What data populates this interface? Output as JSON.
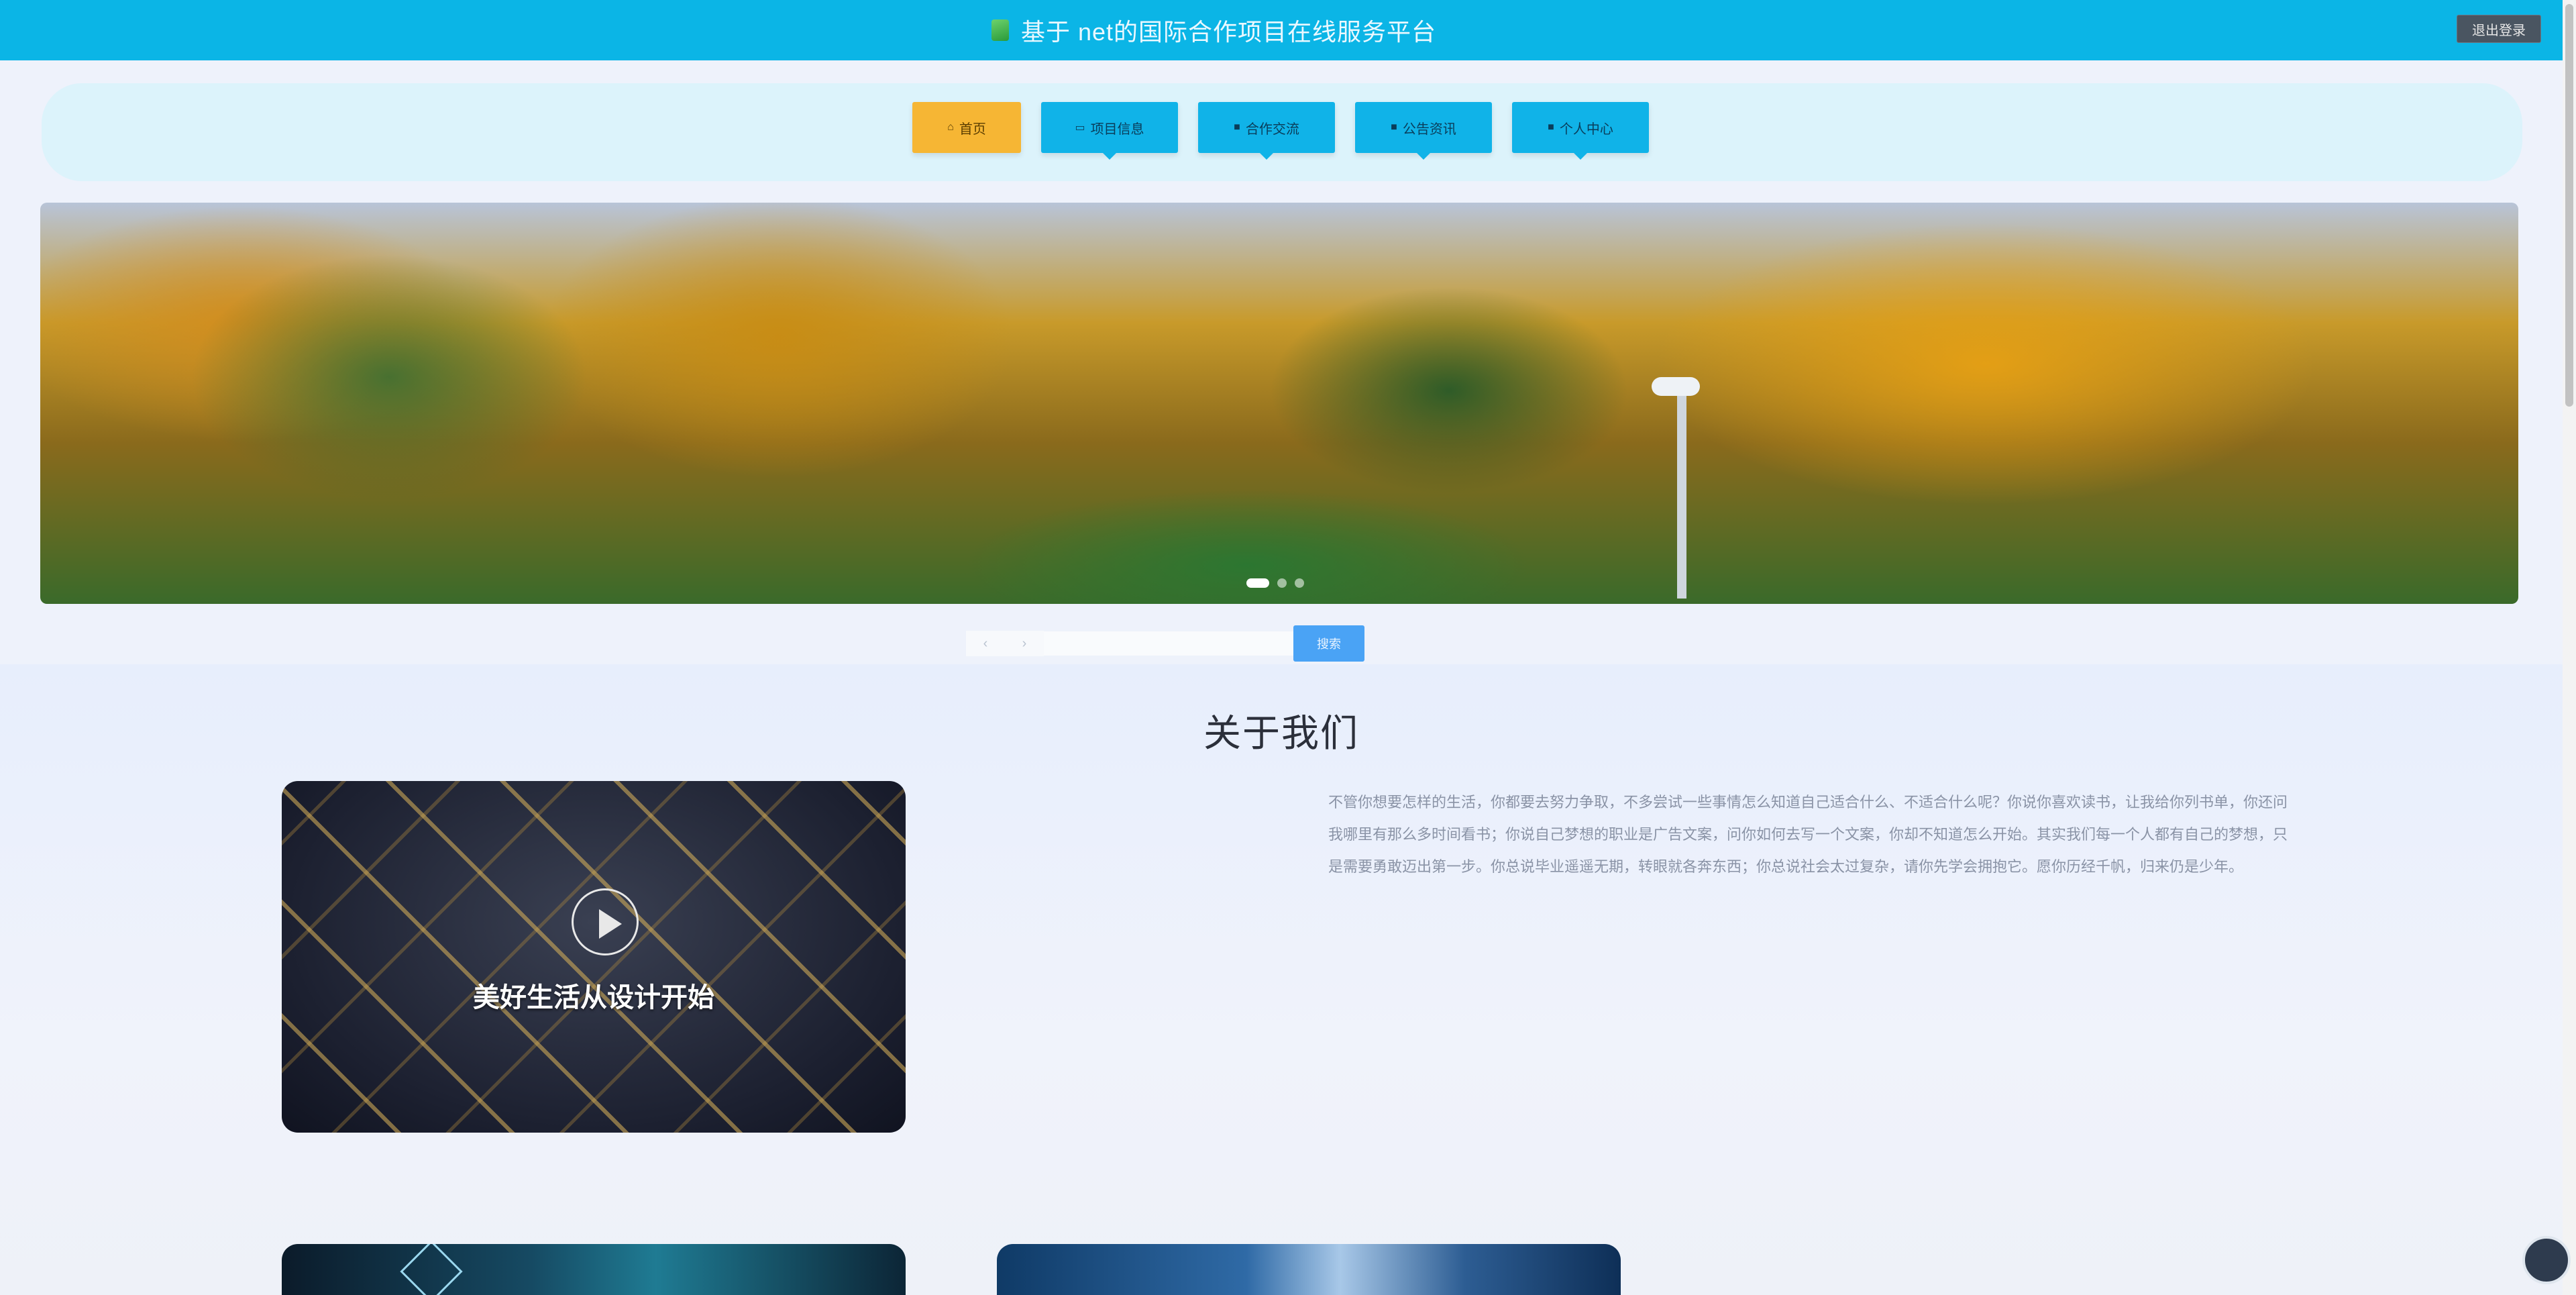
{
  "header": {
    "title": "基于 net的国际合作项目在线服务平台",
    "logout_label": "退出登录",
    "logo_icon": "app-logo-icon"
  },
  "nav": {
    "items": [
      {
        "label": "首页",
        "icon": "home-icon",
        "active": true
      },
      {
        "label": "项目信息",
        "icon": "doc-icon",
        "active": false
      },
      {
        "label": "合作交流",
        "icon": "square-icon",
        "active": false
      },
      {
        "label": "公告资讯",
        "icon": "square-icon",
        "active": false
      },
      {
        "label": "个人中心",
        "icon": "square-icon",
        "active": false
      }
    ],
    "accent_active": "#f6b634",
    "accent": "#10b3e8"
  },
  "carousel": {
    "slide_count": 3,
    "active_index": 0
  },
  "search": {
    "placeholder": "",
    "button_label": "搜索"
  },
  "about": {
    "heading": "关于我们",
    "card_caption": "美好生活从设计开始",
    "paragraph": "不管你想要怎样的生活，你都要去努力争取，不多尝试一些事情怎么知道自己适合什么、不适合什么呢？你说你喜欢读书，让我给你列书单，你还问我哪里有那么多时间看书；你说自己梦想的职业是广告文案，问你如何去写一个文案，你却不知道怎么开始。其实我们每一个人都有自己的梦想，只是需要勇敢迈出第一步。你总说毕业遥遥无期，转眼就各奔东西；你总说社会太过复杂，请你先学会拥抱它。愿你历经千帆，归来仍是少年。"
  },
  "colors": {
    "topbar": "#0bb5e6",
    "nav_bg": "#dcf3fb",
    "search_button": "#4aa3f5"
  }
}
